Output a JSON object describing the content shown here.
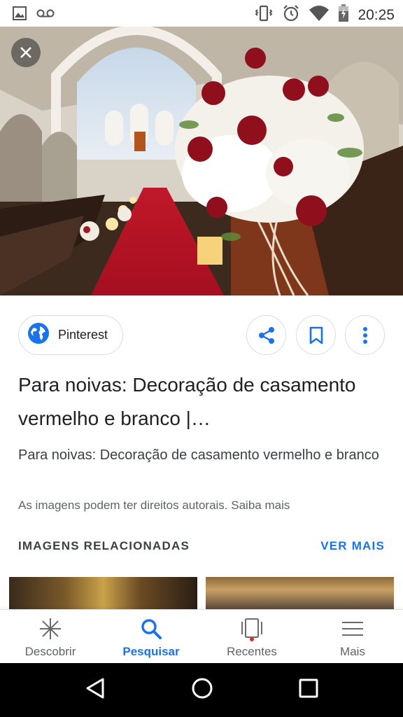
{
  "status_bar": {
    "time": "20:25",
    "icons": [
      "gallery-icon",
      "voicemail-icon",
      "vibrate-icon",
      "alarm-icon",
      "wifi-icon",
      "battery-icon"
    ]
  },
  "hero": {
    "alt_subject": "church-wedding-red-white-flowers"
  },
  "source": {
    "label": "Pinterest",
    "icon": "globe-icon"
  },
  "actions": [
    "share-icon",
    "bookmark-icon",
    "more-vert-icon"
  ],
  "result": {
    "title": "Para noivas: Decoração de casamento vermelho e branco |…",
    "description": "Para noivas: Decoração de casamento vermelho e branco",
    "copyright": "As imagens podem ter direitos autorais. Saiba mais"
  },
  "related": {
    "header": "IMAGENS RELACIONADAS",
    "see_more": "VER MAIS"
  },
  "bottom_nav": {
    "items": [
      {
        "label": "Descobrir",
        "icon": "discover-icon",
        "active": false
      },
      {
        "label": "Pesquisar",
        "icon": "search-icon",
        "active": true
      },
      {
        "label": "Recentes",
        "icon": "recents-icon",
        "active": false
      },
      {
        "label": "Mais",
        "icon": "menu-icon",
        "active": false
      }
    ]
  },
  "colors": {
    "accent": "#1a73e8",
    "text": "#202124",
    "muted": "#5f6368",
    "recent_dot": "#d93025"
  }
}
